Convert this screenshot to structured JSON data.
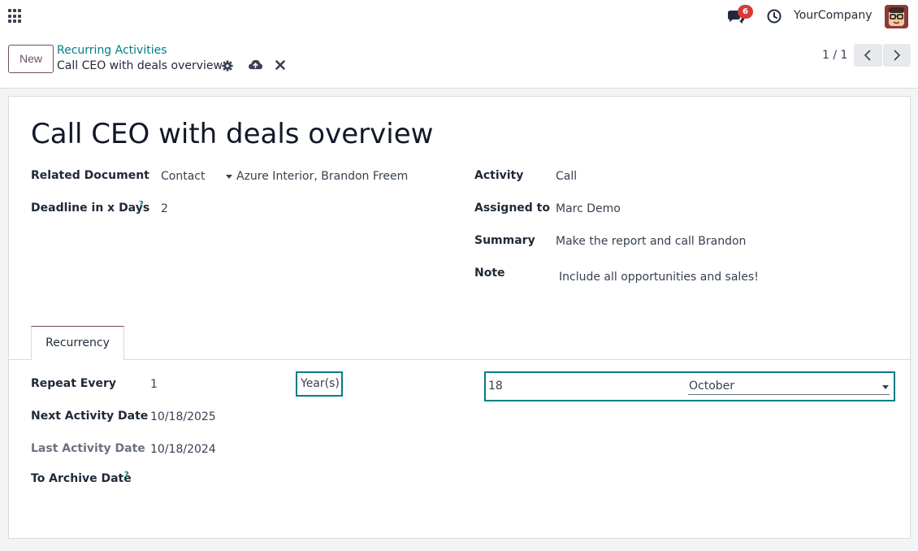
{
  "topbar": {
    "company": "YourCompany",
    "chat_badge": "6",
    "icons": [
      "apps-icon",
      "chat-icon",
      "clock-icon",
      "avatar"
    ]
  },
  "control": {
    "new_label": "New",
    "breadcrumb_parent": "Recurring Activities",
    "breadcrumb_current": "Call CEO with deals overview",
    "pager": "1 / 1"
  },
  "form": {
    "title": "Call CEO with deals overview",
    "related_document": {
      "label": "Related Document",
      "model": "Contact",
      "record": "Azure Interior, Brandon Freem"
    },
    "deadline": {
      "label": "Deadline in x Days",
      "help": "?",
      "value": "2"
    },
    "activity": {
      "label": "Activity",
      "value": "Call"
    },
    "assigned_to": {
      "label": "Assigned to",
      "value": "Marc Demo"
    },
    "summary": {
      "label": "Summary",
      "value": "Make the report and call Brandon"
    },
    "note": {
      "label": "Note",
      "value": "Include all opportunities and sales!"
    }
  },
  "tabs": [
    {
      "label": "Recurrency"
    }
  ],
  "recurrency": {
    "repeat_every": {
      "label": "Repeat Every",
      "value": "1",
      "unit": "Year(s)",
      "day": "18",
      "month": "October"
    },
    "next_activity_date": {
      "label": "Next Activity Date",
      "value": "10/18/2025"
    },
    "last_activity_date": {
      "label": "Last Activity Date",
      "value": "10/18/2024"
    },
    "to_archive_date": {
      "label": "To Archive Date",
      "help": "?"
    }
  },
  "colors": {
    "brand": "#714b67",
    "accent": "#017e84",
    "badge": "#d9383a"
  }
}
